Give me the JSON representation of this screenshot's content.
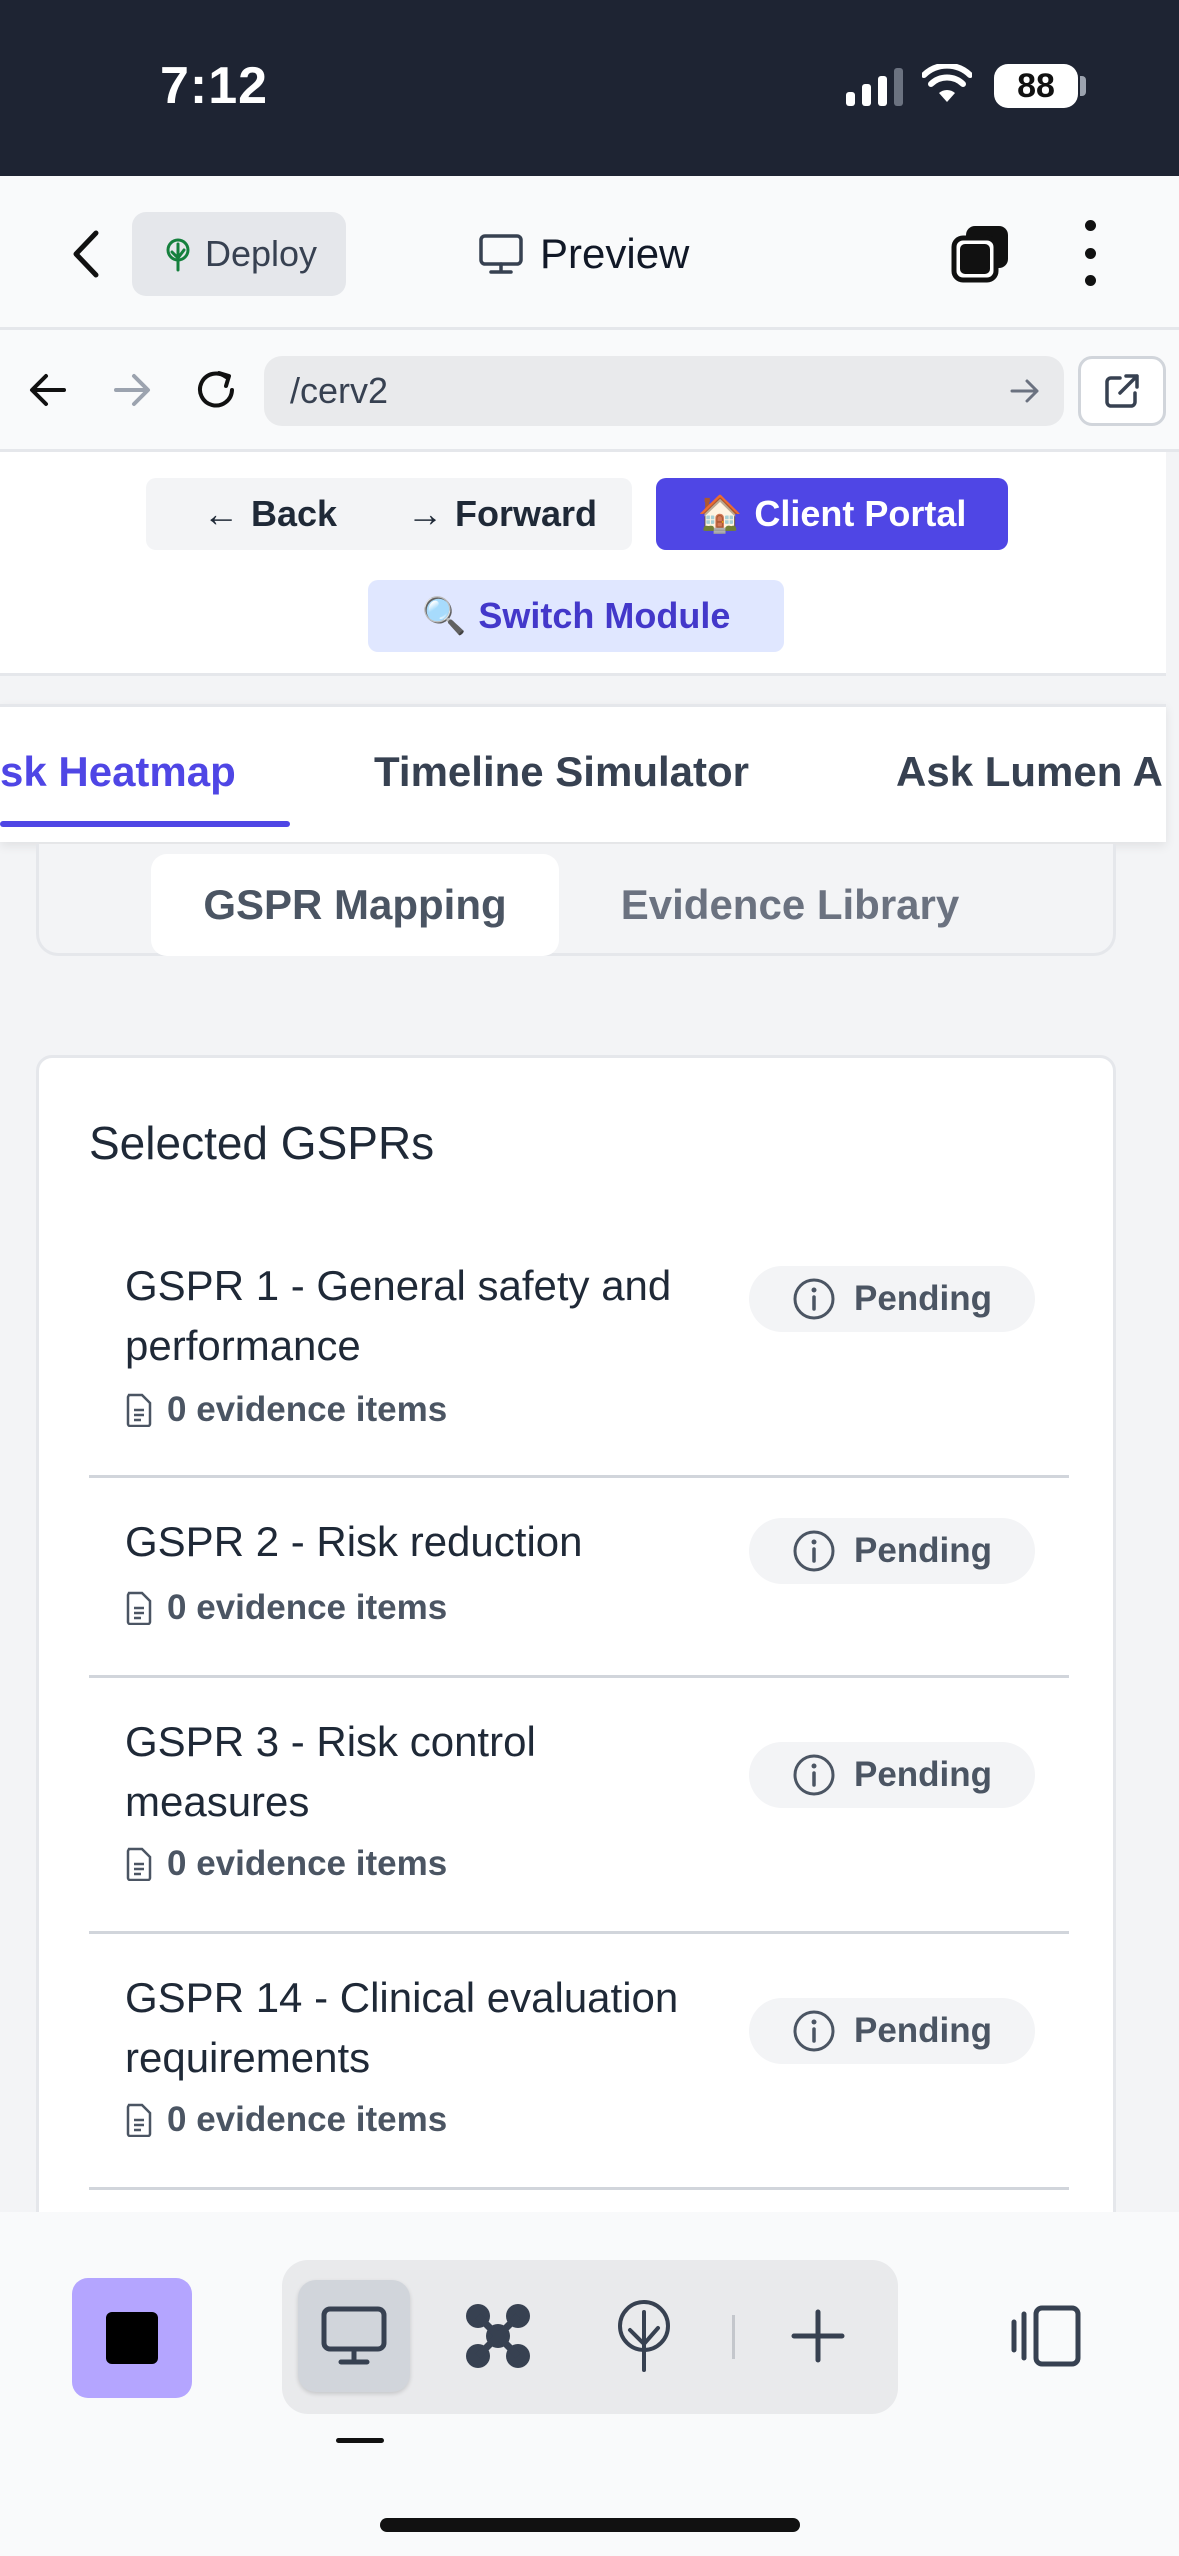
{
  "status_bar": {
    "time": "7:12",
    "battery": "88"
  },
  "app_header": {
    "deploy_label": "Deploy",
    "preview_label": "Preview"
  },
  "url_bar": {
    "path": "/cerv2"
  },
  "nav_buttons": {
    "back": "Back",
    "forward": "Forward",
    "client_portal": "Client Portal",
    "client_portal_emoji": "🏠",
    "switch_module": "Switch Module",
    "switch_module_emoji": "🔍"
  },
  "tabs": [
    {
      "label": "sk Heatmap",
      "active": true
    },
    {
      "label": "Timeline Simulator",
      "active": false
    },
    {
      "label": "Ask Lumen A",
      "active": false
    }
  ],
  "segments": [
    {
      "label": "GSPR Mapping",
      "active": true
    },
    {
      "label": "Evidence Library",
      "active": false
    }
  ],
  "card": {
    "title": "Selected GSPRs",
    "items": [
      {
        "name": "GSPR 1 - General safety and performance",
        "evidence": "0 evidence items",
        "status": "Pending"
      },
      {
        "name": "GSPR 2 - Risk reduction",
        "evidence": "0 evidence items",
        "status": "Pending"
      },
      {
        "name": "GSPR 3 - Risk control measures",
        "evidence": "0 evidence items",
        "status": "Pending"
      },
      {
        "name": "GSPR 14 - Clinical evaluation requirements",
        "evidence": "0 evidence items",
        "status": "Pending"
      }
    ]
  },
  "colors": {
    "accent": "#4f46e5",
    "accent_soft": "#e0e7ff",
    "status_bar_bg": "#1e2433",
    "stop_button": "#b4a5ff"
  },
  "icons": {
    "back": "chevron-left-icon",
    "deploy": "tree-icon",
    "preview": "monitor-icon",
    "layers": "layers-icon",
    "more": "kebab-icon",
    "status": "info-icon",
    "evidence": "document-icon"
  }
}
